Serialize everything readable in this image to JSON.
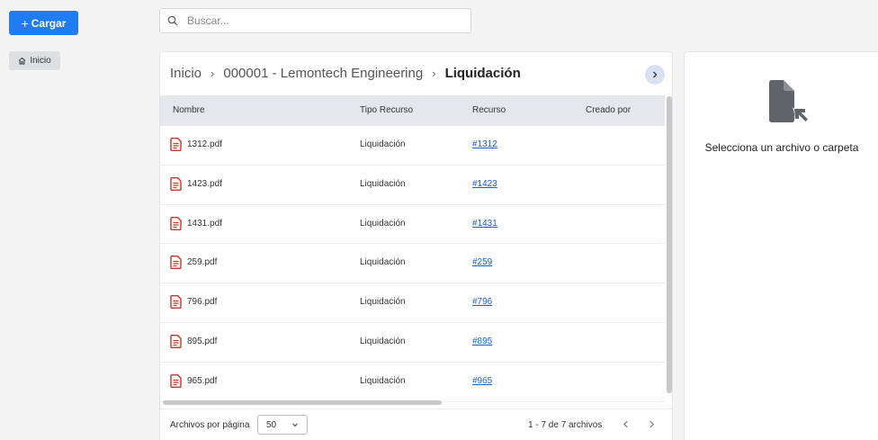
{
  "toolbar": {
    "upload_label": "Cargar",
    "upload_plus": "+"
  },
  "sidebar": {
    "home_label": "Inicio"
  },
  "search": {
    "placeholder": "Buscar..."
  },
  "breadcrumb": {
    "items": [
      "Inicio",
      "000001 - Lemontech Engineering",
      "Liquidación"
    ],
    "separator": "›"
  },
  "table": {
    "columns": [
      "Nombre",
      "Tipo Recurso",
      "Recurso",
      "Creado por"
    ],
    "rows": [
      {
        "name": "1312.pdf",
        "type": "Liquidación",
        "resource": "#1312",
        "created_by": ""
      },
      {
        "name": "1423.pdf",
        "type": "Liquidación",
        "resource": "#1423",
        "created_by": ""
      },
      {
        "name": "1431.pdf",
        "type": "Liquidación",
        "resource": "#1431",
        "created_by": ""
      },
      {
        "name": "259.pdf",
        "type": "Liquidación",
        "resource": "#259",
        "created_by": ""
      },
      {
        "name": "796.pdf",
        "type": "Liquidación",
        "resource": "#796",
        "created_by": ""
      },
      {
        "name": "895.pdf",
        "type": "Liquidación",
        "resource": "#895",
        "created_by": ""
      },
      {
        "name": "965.pdf",
        "type": "Liquidación",
        "resource": "#965",
        "created_by": ""
      }
    ]
  },
  "pagination": {
    "per_page_label": "Archivos por página",
    "per_page_value": "50",
    "range_text": "1 - 7 de 7 archivos"
  },
  "details": {
    "empty_message": "Selecciona un archivo o carpeta"
  },
  "icons": {
    "pdf": "file-pdf-icon",
    "home": "home-icon",
    "search": "search-icon",
    "select_file": "file-pointer-icon"
  },
  "colors": {
    "accent": "#1f7cf2",
    "pdf_icon": "#c0392b",
    "link": "#1a5bd6"
  }
}
